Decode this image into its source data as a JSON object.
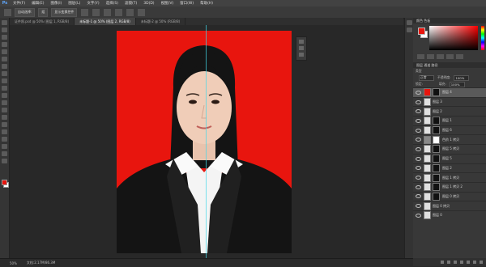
{
  "app": {
    "logo": "Ps",
    "menu": [
      "文件(F)",
      "编辑(E)",
      "图像(I)",
      "图层(L)",
      "文字(Y)",
      "选择(S)",
      "滤镜(T)",
      "3D(D)",
      "视图(V)",
      "窗口(W)",
      "帮助(H)"
    ]
  },
  "options": {
    "tool_preset": "自动选择:",
    "layer_target": "组",
    "transform_label": "显示变换控件"
  },
  "tabs": [
    {
      "label": "证件照.psd @ 50% (图层 1, RGB/8)",
      "active": false
    },
    {
      "label": "未标题-1 @ 50% (图层 2, RGB/8)",
      "active": true
    },
    {
      "label": "未标题-2 @ 50% (RGB/8)",
      "active": false
    }
  ],
  "canvas": {
    "background_color": "#e8150e",
    "guide_color": "#43d7e8"
  },
  "status": {
    "zoom": "50%",
    "doc_size": "文档:2.17M/86.3M"
  },
  "color_panel": {
    "header": "颜色  色板",
    "fg_color": "#e8150e",
    "bg_color": "#ffffff"
  },
  "layers_panel": {
    "header": "图层  通道  路径",
    "kind_label": "类型",
    "blend_mode": "正常",
    "opacity_label": "不透明度:",
    "opacity_value": "100%",
    "lock_label": "锁定:",
    "fill_label": "填充:",
    "fill_value": "100%",
    "layers": [
      {
        "name": "图层 4",
        "thumb": "#e8150e",
        "mask": "#111111",
        "selected": true
      },
      {
        "name": "图层 3",
        "thumb": "#e0e0e0",
        "mask": "",
        "selected": false
      },
      {
        "name": "图层 2",
        "thumb": "#e0e0e0",
        "mask": "",
        "selected": false
      },
      {
        "name": "图层 1",
        "thumb": "#e0e0e0",
        "mask": "#111111",
        "selected": false
      },
      {
        "name": "图层 6",
        "thumb": "#e0e0e0",
        "mask": "#111111",
        "selected": false
      },
      {
        "name": "色阶 1 拷贝",
        "thumb": "#888888",
        "mask": "#ffffff",
        "selected": false
      },
      {
        "name": "图层 5 拷贝",
        "thumb": "#e0e0e0",
        "mask": "#111111",
        "selected": false
      },
      {
        "name": "图层 5",
        "thumb": "#e0e0e0",
        "mask": "#111111",
        "selected": false
      },
      {
        "name": "图层 2",
        "thumb": "#e0e0e0",
        "mask": "#111111",
        "selected": false
      },
      {
        "name": "图层 1 拷贝",
        "thumb": "#e0e0e0",
        "mask": "#111111",
        "selected": false
      },
      {
        "name": "图层 1 拷贝 2",
        "thumb": "#e0e0e0",
        "mask": "#111111",
        "selected": false
      },
      {
        "name": "图层 0 拷贝",
        "thumb": "#e0e0e0",
        "mask": "#111111",
        "selected": false
      },
      {
        "name": "图层 0 拷贝",
        "thumb": "#e0e0e0",
        "mask": "",
        "selected": false
      },
      {
        "name": "图层 0",
        "thumb": "#e0e0e0",
        "mask": "",
        "selected": false
      }
    ]
  }
}
